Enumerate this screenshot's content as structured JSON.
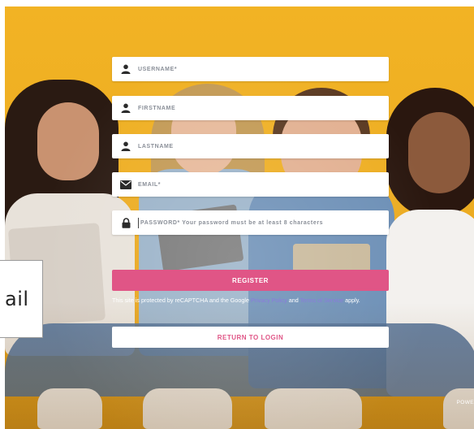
{
  "form": {
    "username_placeholder": "USERNAME*",
    "firstname_placeholder": "FIRSTNAME",
    "lastname_placeholder": "LASTNAME",
    "email_placeholder": "EMAIL*",
    "password_placeholder": "PASSWORD* Your password must be at least 8 characters",
    "register_label": "REGISTER",
    "return_label": "RETURN TO LOGIN"
  },
  "captcha": {
    "text_before": "This site is protected by reCAPTCHA and the Google ",
    "privacy_link": "Privacy Policy",
    "text_and": " and ",
    "terms_link": "Terms of Service",
    "text_after": " apply."
  },
  "footer": {
    "powered_text": "POWE"
  },
  "popup": {
    "text": "ail"
  },
  "icons": [
    "user-icon",
    "envelope-icon",
    "lock-icon"
  ],
  "colors": {
    "accent": "#e05586",
    "link": "#8b7bdc",
    "background": "#f0b023"
  }
}
